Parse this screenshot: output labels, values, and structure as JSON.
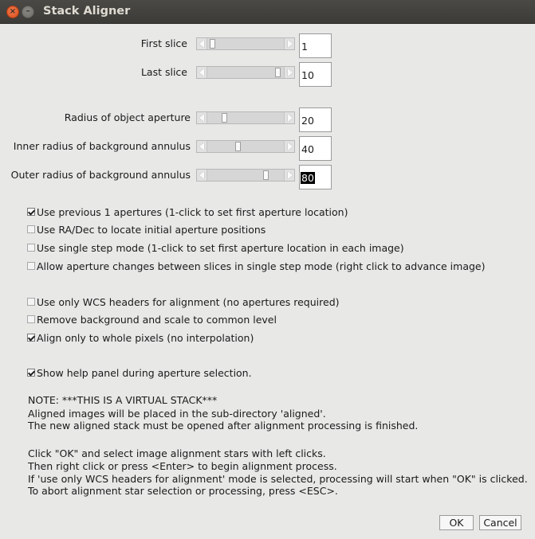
{
  "window": {
    "title": "Stack Aligner"
  },
  "sliders": [
    {
      "label": "First slice",
      "value": "1",
      "selected": false
    },
    {
      "label": "Last slice",
      "value": "10",
      "selected": false
    },
    {
      "label": "Radius of object aperture",
      "value": "20",
      "selected": false
    },
    {
      "label": "Inner radius of background annulus",
      "value": "40",
      "selected": false
    },
    {
      "label": "Outer radius of background annulus",
      "value": "80",
      "selected": true
    }
  ],
  "checkboxes": [
    {
      "label": "Use previous 1 apertures (1-click to set first aperture location)",
      "checked": true
    },
    {
      "label": "Use RA/Dec to locate initial aperture positions",
      "checked": false
    },
    {
      "label": "Use single step mode (1-click to set first aperture location in each image)",
      "checked": false
    },
    {
      "label": "Allow aperture changes between slices in single step mode (right click to advance image)",
      "checked": false
    },
    {
      "label": "Use only WCS headers for alignment (no apertures required)",
      "checked": false
    },
    {
      "label": "Remove background and scale to common level",
      "checked": false
    },
    {
      "label": "Align only to whole pixels (no interpolation)",
      "checked": true
    },
    {
      "label": "Show help panel during aperture selection.",
      "checked": true
    }
  ],
  "notes": [
    "NOTE: ***THIS IS A VIRTUAL STACK***",
    "Aligned images will be placed in the sub-directory 'aligned'.",
    "The new aligned stack must be opened after alignment processing is finished.",
    "Click \"OK\" and select image alignment stars with left clicks.",
    "Then right click or press <Enter> to begin alignment process.",
    "If 'use only WCS headers for alignment' mode is selected, processing will start when \"OK\" is clicked.",
    "To abort alignment star selection or processing, press <ESC>."
  ],
  "buttons": {
    "ok": "OK",
    "cancel": "Cancel"
  }
}
